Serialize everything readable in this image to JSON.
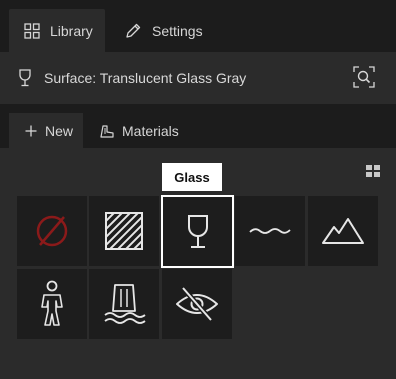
{
  "tabs": {
    "library_label": "Library",
    "settings_label": "Settings"
  },
  "surface": {
    "label": "Surface: Translucent Glass Gray"
  },
  "subtabs": {
    "new_label": "New",
    "materials_label": "Materials"
  },
  "tooltip": {
    "text": "Glass"
  },
  "tiles": [
    {
      "icon": "none-icon",
      "selected": false
    },
    {
      "icon": "hatch-icon",
      "selected": false
    },
    {
      "icon": "glass-icon",
      "selected": true
    },
    {
      "icon": "water-wave-icon",
      "selected": false
    },
    {
      "icon": "mountain-icon",
      "selected": false
    },
    {
      "icon": "person-icon",
      "selected": false
    },
    {
      "icon": "waterfall-icon",
      "selected": false
    },
    {
      "icon": "hidden-eye-icon",
      "selected": false
    }
  ],
  "colors": {
    "none_icon": "#8b1a1a",
    "icon_stroke": "#e6e6e6",
    "selection_border": "#ffffff"
  }
}
